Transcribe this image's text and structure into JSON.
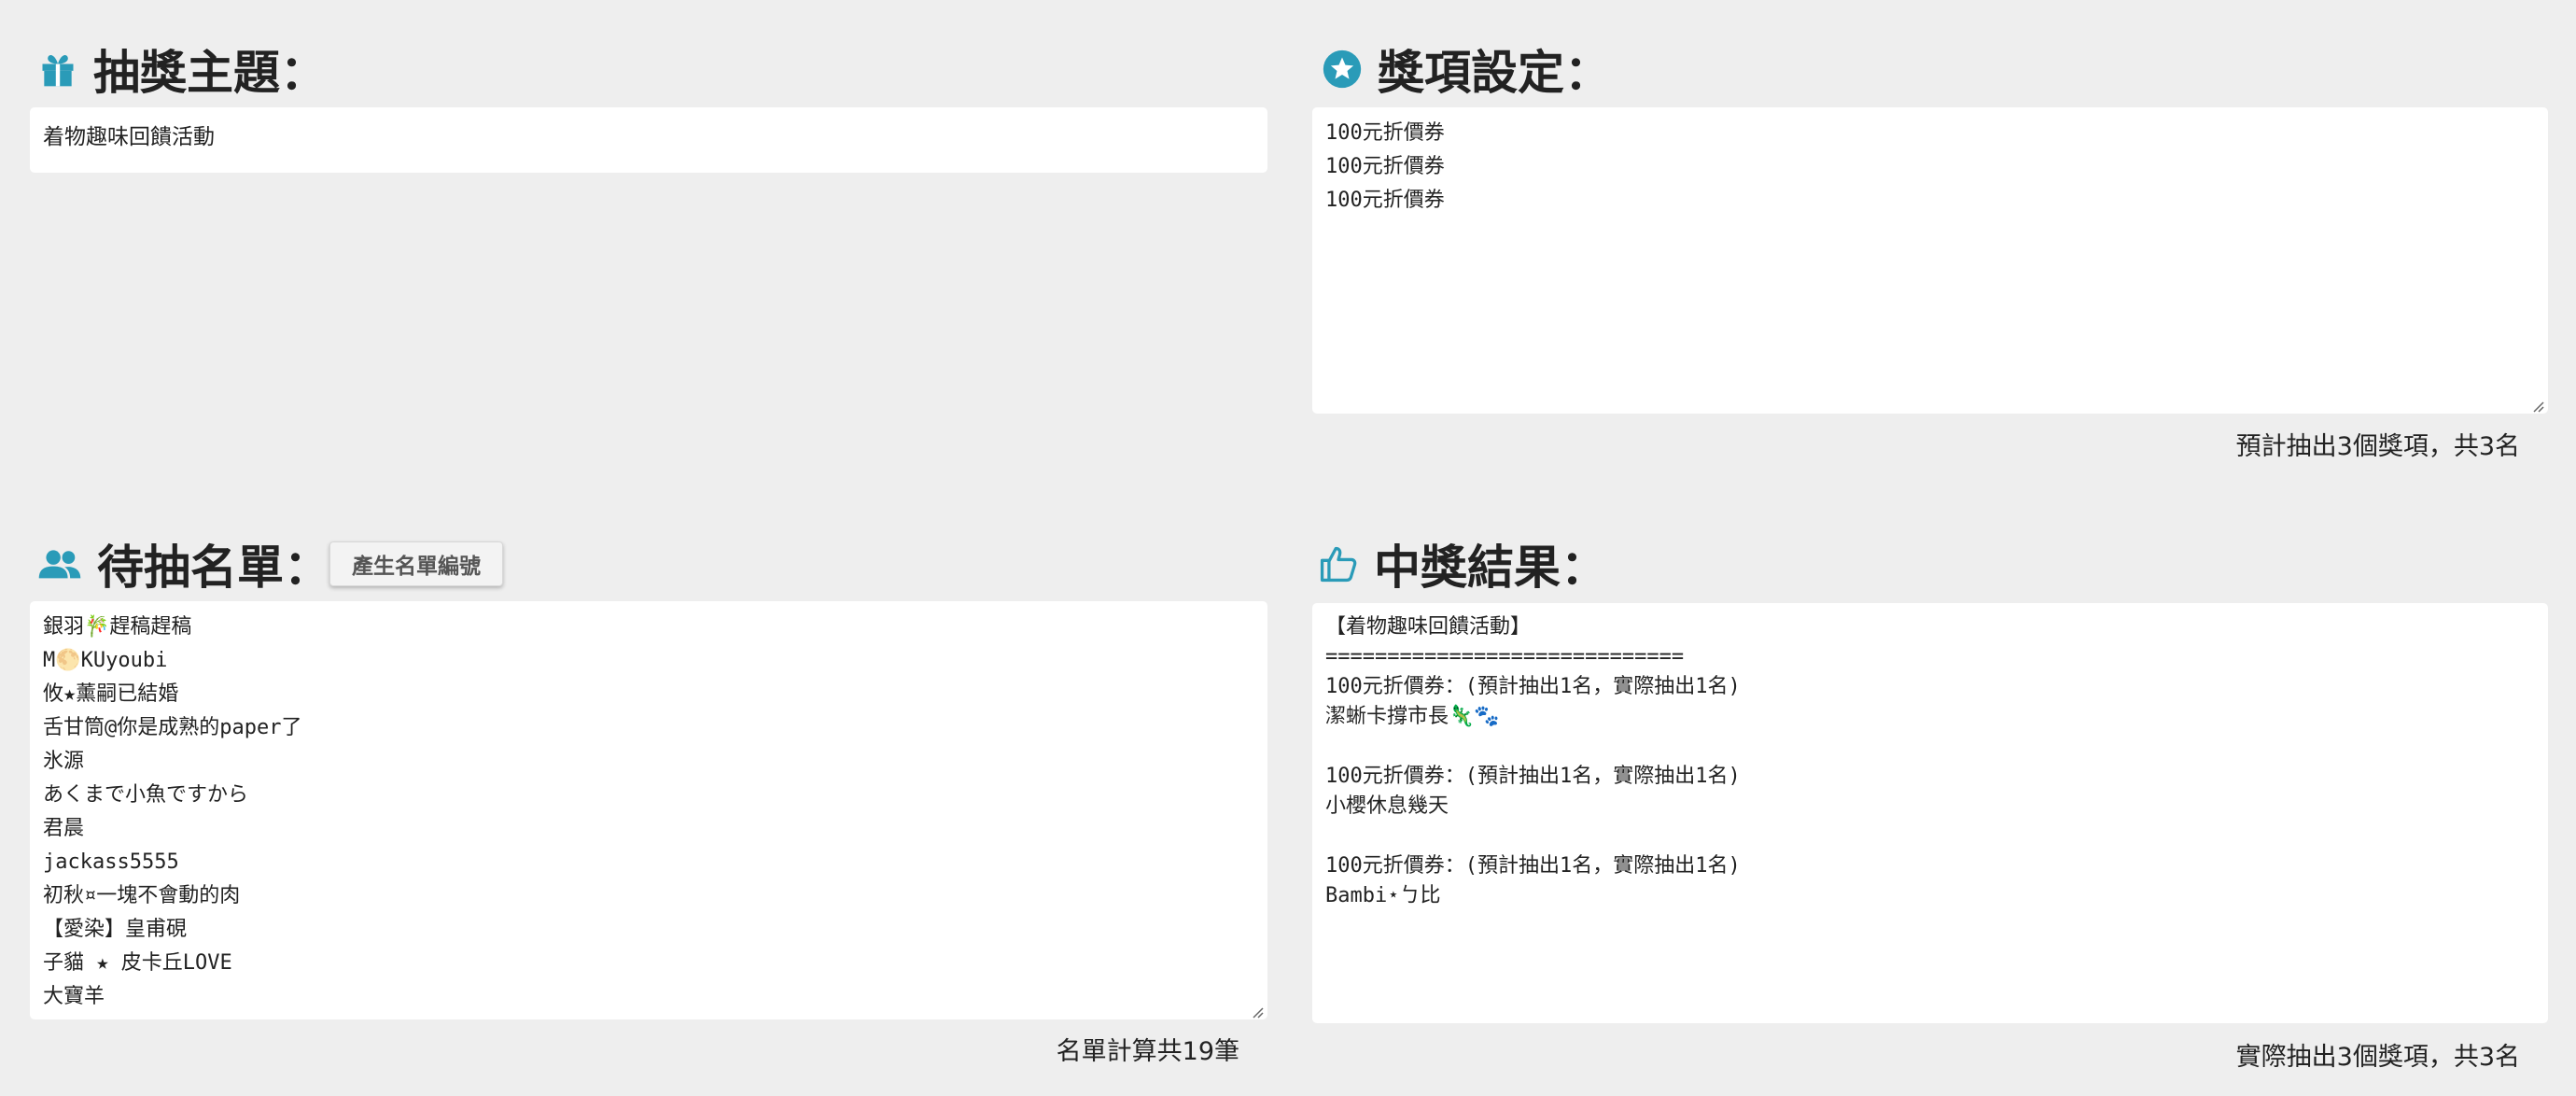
{
  "topic": {
    "heading": "抽獎主題：",
    "value": "着物趣味回饋活動"
  },
  "prizes": {
    "heading": "獎項設定：",
    "lines": [
      "100元折價券",
      "100元折價券",
      "100元折價券"
    ],
    "summary": "預計抽出3個獎項，共3名"
  },
  "candidates": {
    "heading": "待抽名單：",
    "generate_button": "產生名單編號",
    "lines": [
      "銀羽🎋趕稿趕稿",
      "M🌕KUyoubi",
      "攸★薰嗣已結婚",
      "舌甘筒@你是成熟的paper了",
      "氷源",
      "あくまで小魚ですから",
      "君晨",
      "jackass5555",
      "初秋¤一塊不會動的肉",
      "【愛染】皇甫硯",
      "子貓 ★ 皮卡丘LOVE",
      "大寶羊"
    ],
    "summary": "名單計算共19筆"
  },
  "results": {
    "heading": "中獎結果：",
    "lines": [
      "【着物趣味回饋活動】",
      "=============================",
      "100元折價券：(預計抽出1名，實際抽出1名)",
      "潔蜥卡撐市長🦎🐾",
      "",
      "100元折價券：(預計抽出1名，實際抽出1名)",
      "小櫻休息幾天",
      "",
      "100元折價券：(預計抽出1名，實際抽出1名)",
      "Bambi⋆ㄅ比"
    ],
    "summary": "實際抽出3個獎項，共3名"
  },
  "colors": {
    "accent": "#2a9bb8",
    "background": "#eeeeee"
  },
  "icons": {
    "topic": "gift-icon",
    "prizes": "star-circle-icon",
    "candidates": "users-icon",
    "results": "thumbs-up-icon"
  }
}
